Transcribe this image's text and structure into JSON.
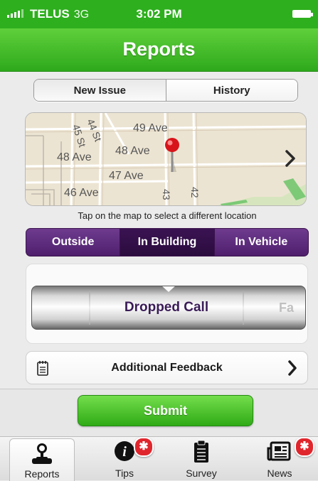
{
  "status_bar": {
    "carrier": "TELUS",
    "network": "3G",
    "time": "3:02 PM"
  },
  "header": {
    "title": "Reports"
  },
  "segment": {
    "tabs": [
      {
        "label": "New Issue",
        "active": true
      },
      {
        "label": "History",
        "active": false
      }
    ]
  },
  "map": {
    "streets": [
      "49 Ave",
      "48 Ave",
      "48 Ave",
      "47 Ave",
      "46 Ave",
      "45 St",
      "44 St",
      "43",
      "42"
    ],
    "hint": "Tap on the map to select a different location",
    "icons": [
      "map-pin-icon",
      "chevron-right-icon"
    ]
  },
  "location": {
    "options": [
      {
        "label": "Outside",
        "selected": false
      },
      {
        "label": "In Building",
        "selected": true
      },
      {
        "label": "In Vehicle",
        "selected": false
      }
    ]
  },
  "issue_picker": {
    "selected": "Dropped Call",
    "next_partial": "Fa"
  },
  "feedback": {
    "label": "Additional Feedback"
  },
  "submit": {
    "label": "Submit"
  },
  "tabbar": {
    "tabs": [
      {
        "label": "Reports",
        "icon": "joystick-icon",
        "active": true
      },
      {
        "label": "Tips",
        "icon": "info-icon",
        "badge": "✱"
      },
      {
        "label": "Survey",
        "icon": "clipboard-icon"
      },
      {
        "label": "News",
        "icon": "newspaper-icon",
        "badge": "✱"
      }
    ]
  },
  "colors": {
    "brand_green": "#2eaf1e",
    "purple": "#4f1f6d",
    "badge_red": "#e0262d"
  }
}
